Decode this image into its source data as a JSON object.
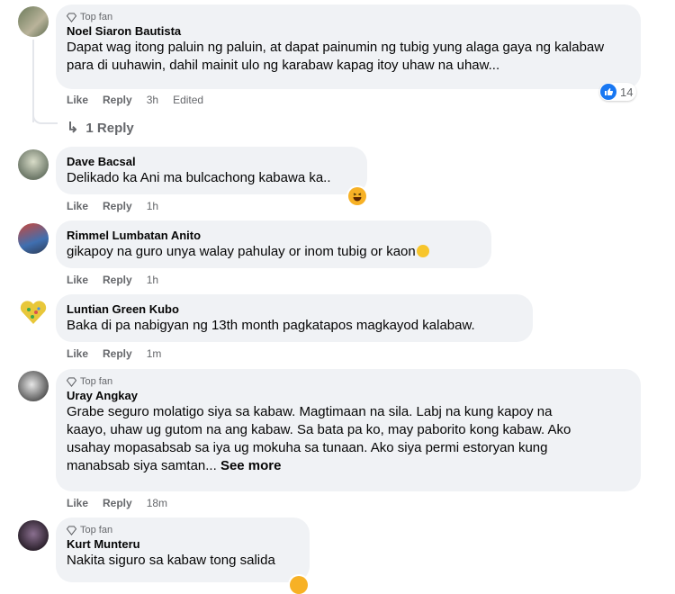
{
  "comments": [
    {
      "top_fan": "Top fan",
      "author": "Noel Siaron Bautista",
      "text": "Dapat wag itong paluin ng paluin, at dapat painumin ng tubig yung alaga gaya ng kalabaw para di uuhawin, dahil mainit ulo ng karabaw kapag itoy uhaw na uhaw...",
      "like": "Like",
      "reply": "Reply",
      "time": "3h",
      "edited": "Edited",
      "reaction_count": "14",
      "replies_label": "1 Reply"
    },
    {
      "author": "Dave Bacsal",
      "text": "Delikado ka Ani ma bulcachong kabawa ka..",
      "like": "Like",
      "reply": "Reply",
      "time": "1h"
    },
    {
      "author": "Rimmel Lumbatan Anito",
      "text": "gikapoy na guro unya walay pahulay or inom tubig or kaon",
      "like": "Like",
      "reply": "Reply",
      "time": "1h"
    },
    {
      "author": "Luntian Green Kubo",
      "text": "Baka di pa nabigyan ng 13th month pagkatapos magkayod kalabaw.",
      "like": "Like",
      "reply": "Reply",
      "time": "1m"
    },
    {
      "top_fan": "Top fan",
      "author": "Uray Angkay",
      "text_lines": [
        "Grabe seguro molatigo siya sa kabaw. Magtimaan na sila. Labj na kung kapoy na",
        "kaayo, uhaw ug gutom na ang kabaw. Sa bata pa ko, may paborito kong kabaw. Ako",
        "usahay mopasabsab sa iya ug mokuha sa tunaan. Ako siya permi estoryan kung",
        "manabsab siya samtan..."
      ],
      "see_more": "See more",
      "like": "Like",
      "reply": "Reply",
      "time": "18m"
    },
    {
      "top_fan": "Top fan",
      "author": "Kurt Munteru",
      "text": "Nakita siguro sa kabaw tong salida"
    }
  ],
  "colors": {
    "bubble": "#f0f2f5",
    "meta": "#65676b",
    "like_blue": "#1877f2",
    "haha_yellow": "#f7b125"
  }
}
